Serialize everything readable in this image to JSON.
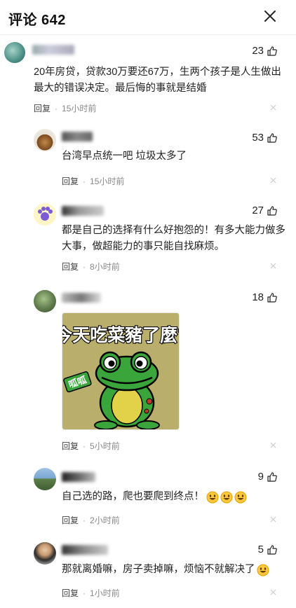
{
  "header": {
    "title": "评论 642"
  },
  "comments": [
    {
      "likes": "23",
      "text_line1": "20年房贷，贷款30万要还67万，生两个孩子是人生做出",
      "text_line2": "最大的错误决定。最后悔的事就是结婚",
      "reply": "回复",
      "time": "15小时前"
    },
    {
      "likes": "53",
      "text_line1": "台湾早点统一吧 垃圾太多了",
      "reply": "回复",
      "time": "15小时前"
    },
    {
      "likes": "27",
      "text_line1": "都是自己的选择有什么好抱怨的！有多大能力做多",
      "text_line2": "大事，做超能力的事只能自找麻烦。",
      "reply": "回复",
      "time": "8小时前"
    },
    {
      "likes": "18",
      "sticker_text": "今天吃菜豬了麼?",
      "sticker_side_text": "呱呱",
      "reply": "回复",
      "time": "5小时前"
    },
    {
      "likes": "9",
      "text_line1": "自己选的路，爬也要爬到终点！",
      "reply": "回复",
      "time": "2小时前"
    },
    {
      "likes": "5",
      "text_line1": "那就离婚嘛，房子卖掉嘛，烦恼不就解决了",
      "reply": "回复",
      "time": "1小时前"
    }
  ],
  "separator": "·",
  "icons": {
    "close": "close-icon",
    "like": "thumbs-up-icon",
    "emoji": "grinning-emoji-icon"
  },
  "colors": {
    "sticker_bg": "#b9ae6c",
    "sticker_title_stroke": "#000000",
    "sticker_title_fill": "#ffffff",
    "frog_green": "#3aa53a",
    "frog_belly": "#e2d24a",
    "side_badge": "#3aa53a"
  }
}
